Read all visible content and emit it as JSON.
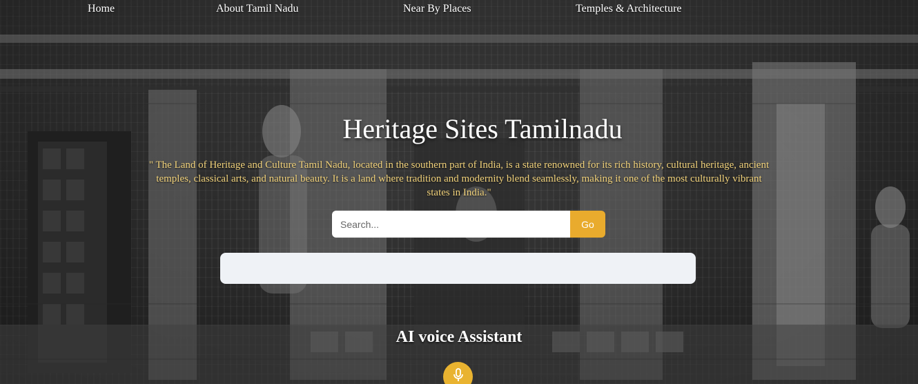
{
  "nav": {
    "items": [
      {
        "label": "Home"
      },
      {
        "label": "About Tamil Nadu"
      },
      {
        "label": "Near By Places"
      },
      {
        "label": "Temples & Architecture"
      }
    ]
  },
  "hero": {
    "title": "Heritage Sites Tamilnadu",
    "description": "\" The Land of Heritage and Culture Tamil Nadu, located in the southern part of India, is a state renowned for its rich history, cultural heritage, ancient temples, classical arts, and natural beauty. It is a land where tradition and modernity blend seamlessly, making it one of the most culturally vibrant states in India.\""
  },
  "search": {
    "placeholder": "Search...",
    "value": "",
    "button_label": "Go"
  },
  "assistant": {
    "title": "AI voice Assistant",
    "mic_icon": "microphone-icon"
  },
  "colors": {
    "accent": "#e9ab2d",
    "description_text": "#f1d27b",
    "results_box": "#eff2f6"
  }
}
